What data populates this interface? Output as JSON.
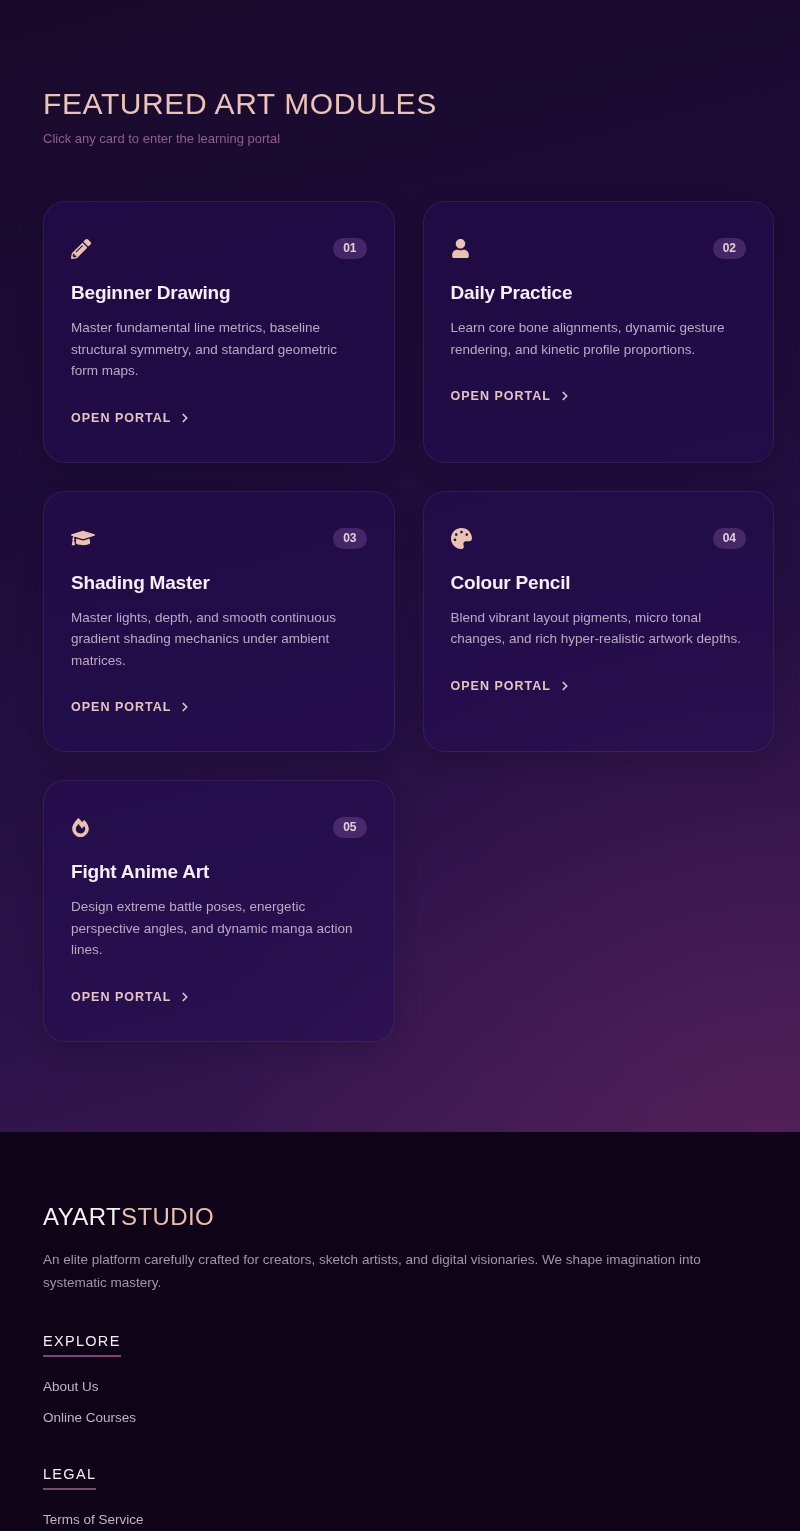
{
  "header": {
    "title": "FEATURED ART MODULES",
    "subtitle": "Click any card to enter the learning portal"
  },
  "modules": [
    {
      "number": "01",
      "title": "Beginner Drawing",
      "description": "Master fundamental line metrics, baseline structural symmetry, and standard geometric form maps.",
      "link": "OPEN PORTAL"
    },
    {
      "number": "02",
      "title": "Daily Practice",
      "description": "Learn core bone alignments, dynamic gesture rendering, and kinetic profile proportions.",
      "link": "OPEN PORTAL"
    },
    {
      "number": "03",
      "title": "Shading Master",
      "description": "Master lights, depth, and smooth continuous gradient shading mechanics under ambient matrices.",
      "link": "OPEN PORTAL"
    },
    {
      "number": "04",
      "title": "Colour Pencil",
      "description": "Blend vibrant layout pigments, micro tonal changes, and rich hyper-realistic artwork depths.",
      "link": "OPEN PORTAL"
    },
    {
      "number": "05",
      "title": "Fight Anime Art",
      "description": "Design extreme battle poses, energetic perspective angles, and dynamic manga action lines.",
      "link": "OPEN PORTAL"
    }
  ],
  "footer": {
    "logo": {
      "primary": "AYART",
      "accent": "STUDIO"
    },
    "description": "An elite platform carefully crafted for creators, sketch artists, and digital visionaries. We shape imagination into systematic mastery.",
    "sections": [
      {
        "heading": "EXPLORE",
        "links": [
          "About Us",
          "Online Courses"
        ]
      },
      {
        "heading": "LEGAL",
        "links": [
          "Terms of Service"
        ]
      }
    ]
  }
}
